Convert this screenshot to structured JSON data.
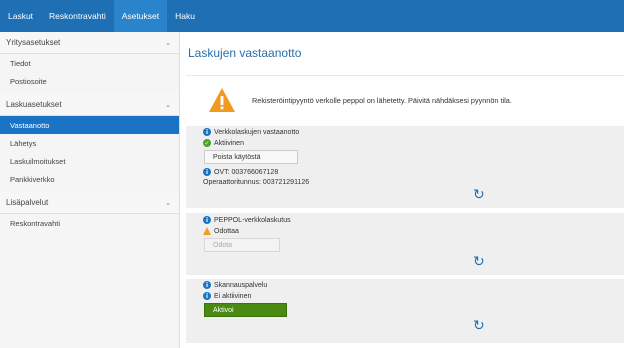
{
  "topnav": {
    "items": [
      {
        "label": "Laskut"
      },
      {
        "label": "Reskontravahti"
      },
      {
        "label": "Asetukset"
      },
      {
        "label": "Haku"
      }
    ]
  },
  "sidebar": {
    "groups": [
      {
        "label": "Yritysasetukset",
        "items": [
          {
            "label": "Tiedot"
          },
          {
            "label": "Postiosoite"
          }
        ]
      },
      {
        "label": "Laskuasetukset",
        "items": [
          {
            "label": "Vastaanotto"
          },
          {
            "label": "Lähetys"
          },
          {
            "label": "Laskuilmoitukset"
          },
          {
            "label": "Pankkiverkko"
          }
        ]
      },
      {
        "label": "Lisäpalvelut",
        "items": [
          {
            "label": "Reskontravahti"
          }
        ]
      }
    ]
  },
  "main": {
    "title": "Laskujen vastaanotto",
    "alert": {
      "text": "Rekisteröintipyyntö verkolle peppol on lähetetty. Päivitä nähdäksesi pyynnön tila."
    },
    "panels": [
      {
        "title": "Verkkolaskujen vastaanotto",
        "status": "Aktiivinen",
        "button": "Poista käytöstä",
        "ovt": "OVT: 003766067128",
        "operator": "Operaattoritunnus: 003721291126"
      },
      {
        "title": "PEPPOL-verkkolaskutus",
        "status": "Odottaa",
        "button": "Odota"
      },
      {
        "title": "Skannauspalvelu",
        "status": "Ei aktiivinen",
        "button": "Aktivoi"
      }
    ]
  },
  "colors": {
    "brand": "#1f6fb4",
    "active": "#1a73c5",
    "success": "#4a8a12",
    "warning": "#f0a020"
  }
}
